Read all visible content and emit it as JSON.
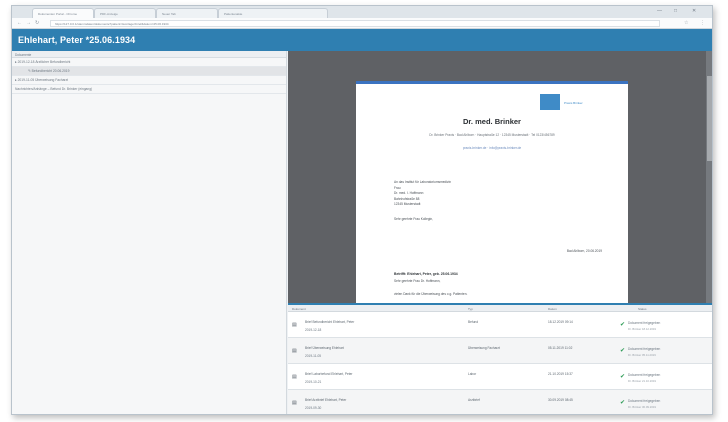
{
  "browser": {
    "tabs": [
      {
        "label": "Dokumenten Portal - Chrome"
      },
      {
        "label": "PDF-Anzeige"
      },
      {
        "label": "Neuer Tab"
      },
      {
        "label": "Patientenakte"
      }
    ],
    "url": "https://127.0.0.1/stammdaten/dokumente?patient=&vorlage=brief&datum=25.06.1934"
  },
  "header": {
    "title": "Ehlehart, Peter *25.06.1934"
  },
  "tree": {
    "header": "Dokumente",
    "items": [
      {
        "label": "▸ 2019-12-18 Ärztlicher Befundbericht",
        "selected": false,
        "child": false
      },
      {
        "label": "✎ Befundbericht 20.06.2019",
        "selected": true,
        "child": true
      },
      {
        "label": "▸ 2019-11-05 Überweisung Facharzt",
        "selected": false,
        "child": false
      },
      {
        "label": "Nachrichten/Anhänge – Befund Dr. Brinker (eingang)",
        "selected": false,
        "child": false
      }
    ]
  },
  "letter": {
    "logo_text": "Praxis Brinker",
    "doctor": "Dr. med. Brinker",
    "address": "Dr. Brinker Praxis · Bad Ahlborn · Hauptstraße 12 · 12345 Musterstadt · Tel 0123/456789",
    "link": "praxis-brinker.de · info@praxis-brinker.de",
    "recipient": [
      "An das Institut für Laboratoriumsmedizin",
      "Frau",
      "Dr. med. I. Hoffmann",
      "Bahnhofstraße 88",
      "12345 Musterstadt"
    ],
    "salutation": "Sehr geehrte Frau Kollegin,",
    "place_date": "Bad Ahlborn, 20.06.2019",
    "subject": "Betrifft: Ehlehart, Peter, geb. 25.06.1934",
    "dear": "Sehr geehrte Frau Dr. Hoffmann,",
    "body": "vielen Dank für die Überweisung des o.g. Patienten."
  },
  "documents": {
    "columns": [
      "Dokument",
      "Typ",
      "Datum",
      "Status"
    ],
    "rows": [
      {
        "name": "Brief Befundbericht Ehlehart, Peter",
        "sub": "2019-12-18",
        "type": "Befund",
        "date": "18.12.2019 09:14",
        "status": "Dokument freigegeben",
        "status_sub": "Dr. Brinker 18.12.2019"
      },
      {
        "name": "Brief Überweisung Ehlehart",
        "sub": "2019-11-05",
        "type": "Überweisung Facharzt",
        "date": "05.11.2019 11:02",
        "status": "Dokument freigegeben",
        "status_sub": "Dr. Brinker 05.11.2019"
      },
      {
        "name": "Brief Laborbefund Ehlehart, Peter",
        "sub": "2019-10-21",
        "type": "Labor",
        "date": "21.10.2019 15:37",
        "status": "Dokument freigegeben",
        "status_sub": "Dr. Brinker 21.10.2019"
      },
      {
        "name": "Brief Arztbrief Ehlehart, Peter",
        "sub": "2019-09-30",
        "type": "Arztbrief",
        "date": "30.09.2019 08:45",
        "status": "Dokument freigegeben",
        "status_sub": "Dr. Brinker 30.09.2019"
      }
    ]
  },
  "colors": {
    "accent": "#2f7fb1",
    "check": "#2d9b56",
    "viewer": "#5f6165"
  }
}
